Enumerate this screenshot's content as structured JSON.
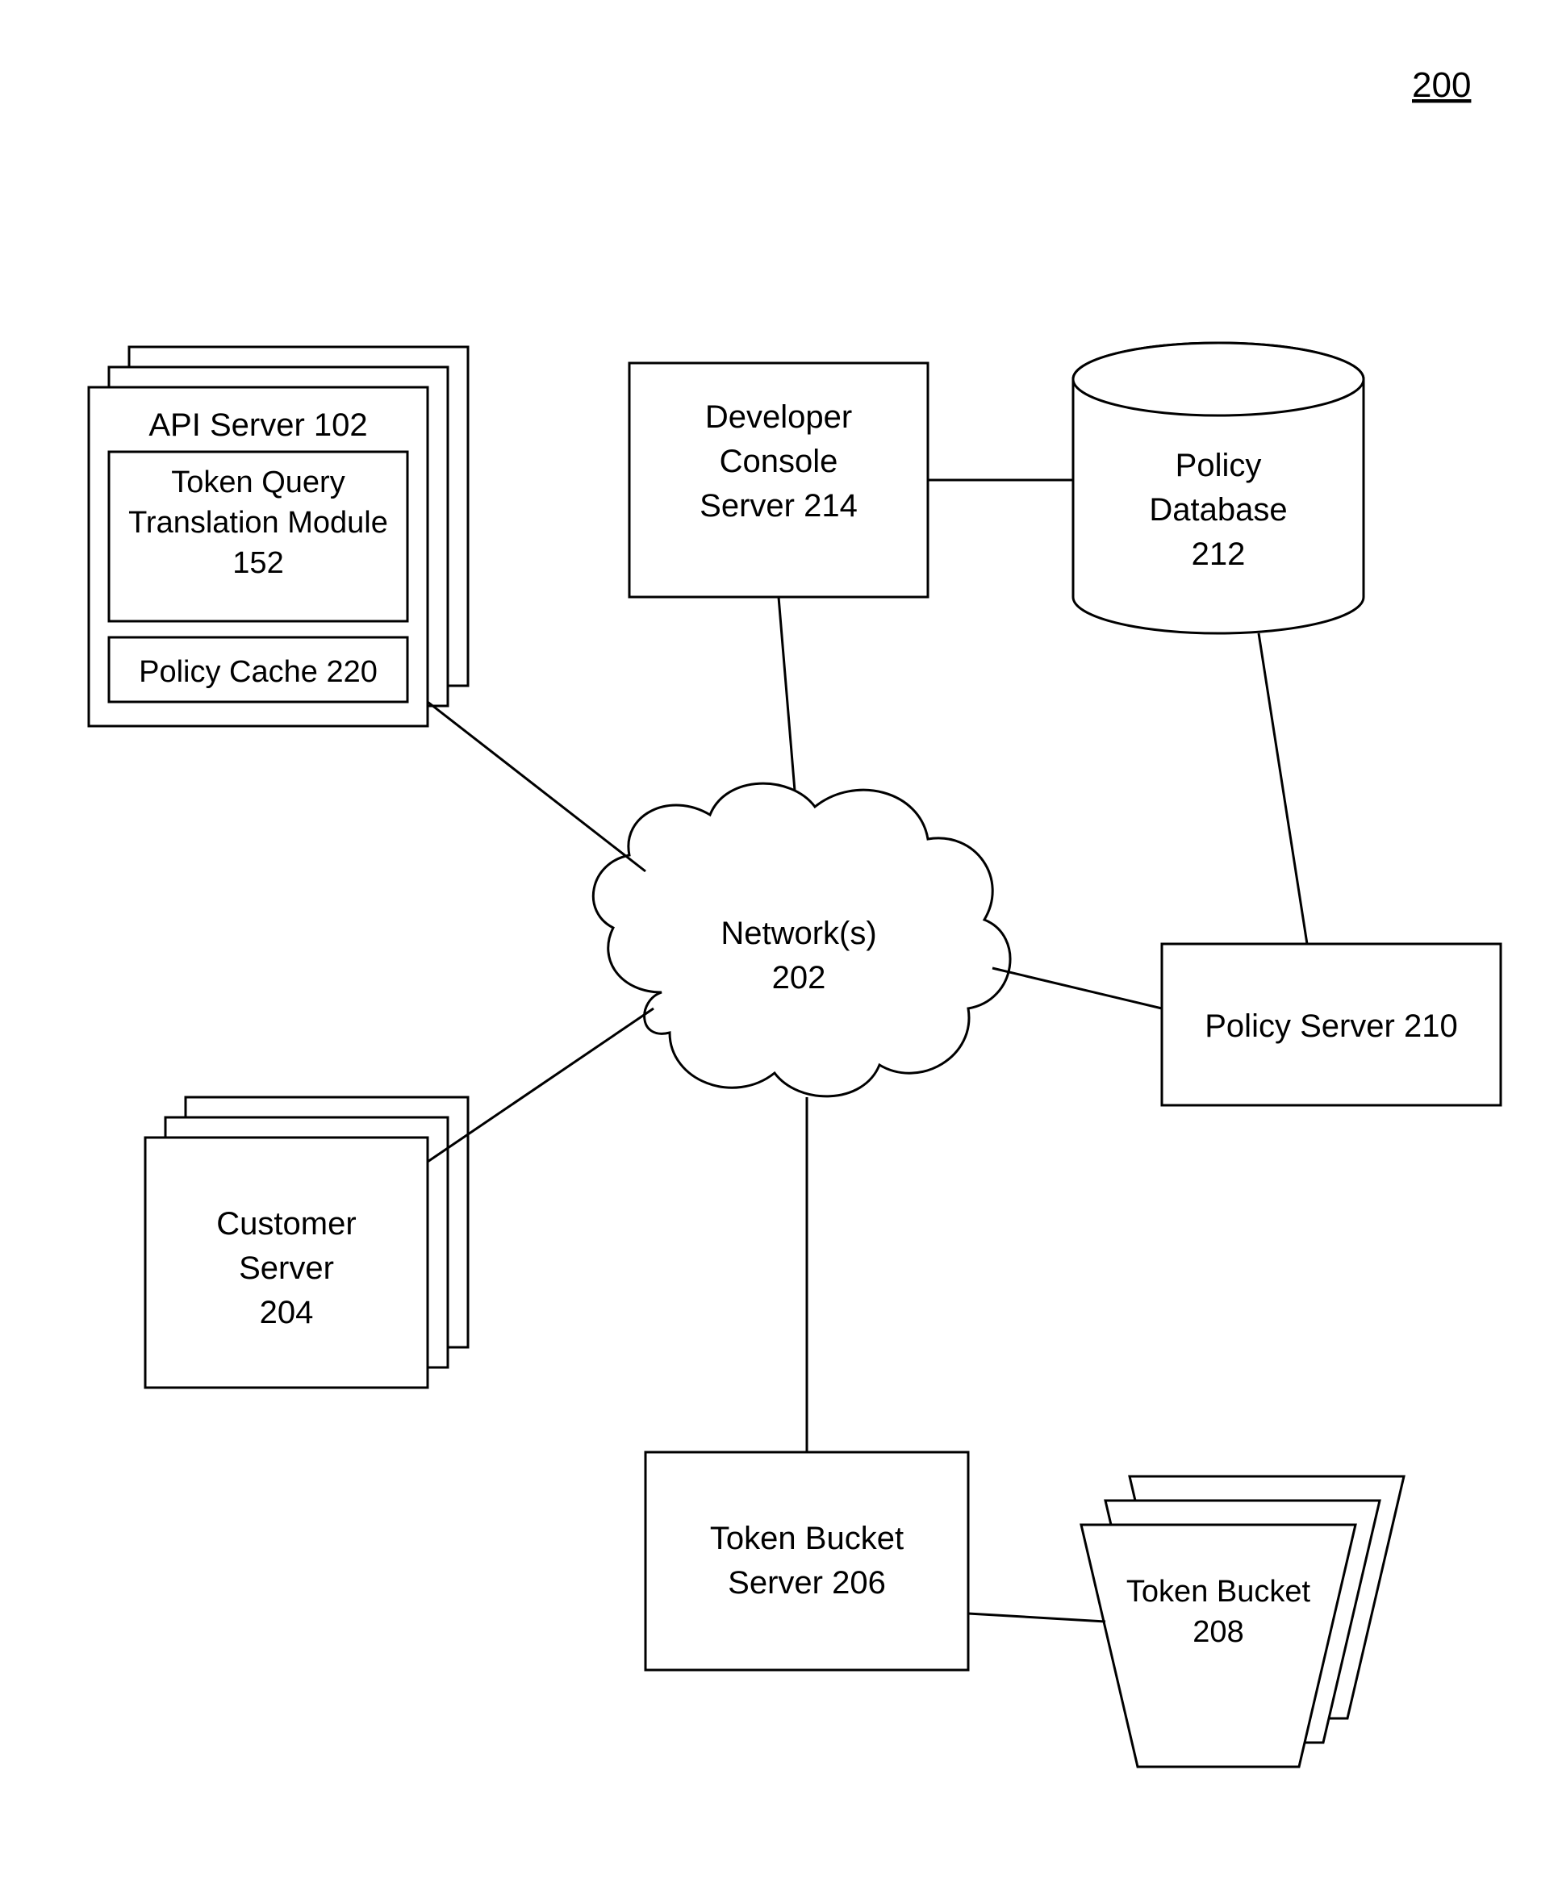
{
  "figure_number": "200",
  "api_server": {
    "title": "API Server 102",
    "module_line1": "Token Query",
    "module_line2": "Translation Module",
    "module_line3": "152",
    "cache": "Policy Cache 220"
  },
  "developer_console": {
    "line1": "Developer",
    "line2": "Console",
    "line3": "Server 214"
  },
  "policy_db": {
    "line1": "Policy",
    "line2": "Database",
    "line3": "212"
  },
  "network": {
    "line1": "Network(s)",
    "line2": "202"
  },
  "policy_server": {
    "label": "Policy Server 210"
  },
  "customer_server": {
    "line1": "Customer",
    "line2": "Server",
    "line3": "204"
  },
  "token_bucket_server": {
    "line1": "Token Bucket",
    "line2": "Server 206"
  },
  "token_bucket": {
    "line1": "Token Bucket",
    "line2": "208"
  }
}
